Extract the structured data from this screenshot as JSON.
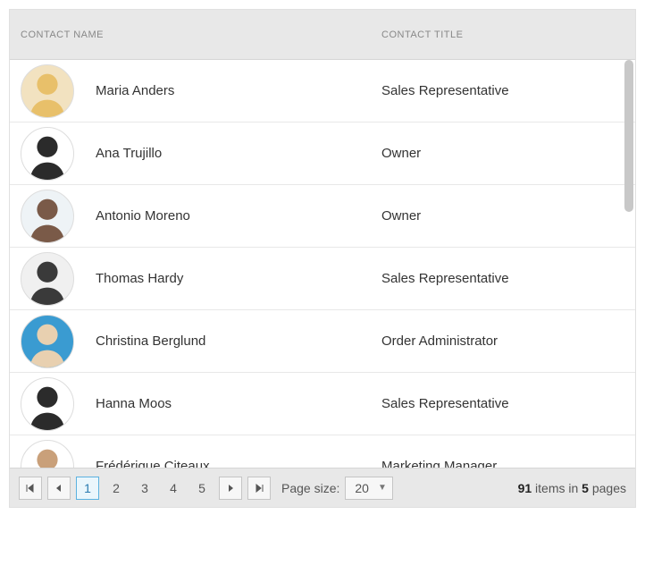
{
  "columns": {
    "name": "CONTACT NAME",
    "title": "CONTACT TITLE"
  },
  "rows": [
    {
      "name": "Maria Anders",
      "title": "Sales Representative",
      "avatar_bg": "#f2e2c0",
      "avatar_fg": "#e8c06a"
    },
    {
      "name": "Ana Trujillo",
      "title": "Owner",
      "avatar_bg": "#ffffff",
      "avatar_fg": "#2b2b2b"
    },
    {
      "name": "Antonio Moreno",
      "title": "Owner",
      "avatar_bg": "#eef3f6",
      "avatar_fg": "#7a5a48"
    },
    {
      "name": "Thomas Hardy",
      "title": "Sales Representative",
      "avatar_bg": "#f0f0f0",
      "avatar_fg": "#3a3a3a"
    },
    {
      "name": "Christina Berglund",
      "title": "Order Administrator",
      "avatar_bg": "#3a9bd1",
      "avatar_fg": "#e8d0b0"
    },
    {
      "name": "Hanna Moos",
      "title": "Sales Representative",
      "avatar_bg": "#ffffff",
      "avatar_fg": "#2b2b2b"
    },
    {
      "name": "Frédérique Citeaux",
      "title": "Marketing Manager",
      "avatar_bg": "#ffffff",
      "avatar_fg": "#c9a07a"
    }
  ],
  "pager": {
    "pages": [
      "1",
      "2",
      "3",
      "4",
      "5"
    ],
    "current": "1",
    "size_label": "Page size:",
    "size_value": "20",
    "total_items": "91",
    "total_pages": "5",
    "status_items_word": " items in ",
    "status_pages_word": " pages"
  }
}
